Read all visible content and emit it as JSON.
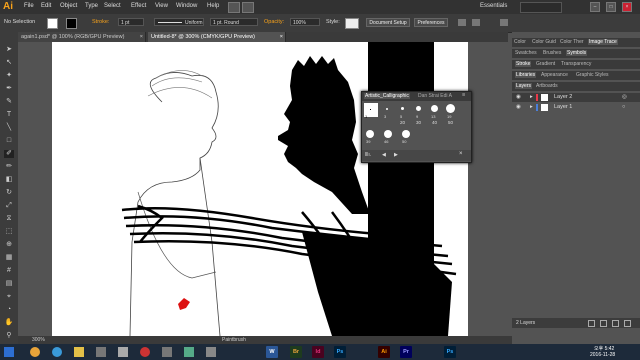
{
  "app": {
    "logo": "Ai",
    "workspace": "Essentials"
  },
  "menu": [
    "File",
    "Edit",
    "Object",
    "Type",
    "Select",
    "Effect",
    "View",
    "Window",
    "Help"
  ],
  "window_controls": [
    "–",
    "□",
    "×"
  ],
  "control_bar": {
    "selection": "No Selection",
    "stroke_label": "Stroke:",
    "stroke_value": "1 pt",
    "brush_line_label": "Uniform",
    "brush_label": "1 pt. Round",
    "opacity_label": "Opacity:",
    "opacity_value": "100%",
    "style_label": "Style:",
    "document_setup": "Document Setup",
    "preferences": "Preferences"
  },
  "tabs": [
    {
      "label": "again1.psd* @ 100% (RGB/GPU Preview)",
      "close": "×"
    },
    {
      "label": "Untitled-8* @ 300% (CMYK/GPU Preview)",
      "close": "×"
    }
  ],
  "brush_panel": {
    "title": "Artistic_Calligraphic",
    "extra_tabs": "Dan Strai Edi A",
    "sizes_row1": [
      "1",
      "3",
      "5",
      "9",
      "13",
      "19"
    ],
    "sizes_row2": [
      "20",
      "30",
      "40",
      "50"
    ],
    "sizes_row3": [
      "39",
      "46",
      "50"
    ],
    "footer_label": "lllı.",
    "close": "×",
    "menu": "≡"
  },
  "right_panels": {
    "top_tabs": [
      "Color",
      "Color Guid",
      "Color Ther",
      "Image Trace"
    ],
    "mid_tabs": [
      "Swatches",
      "Brushes",
      "Symbols"
    ],
    "stroke_tabs": [
      "Stroke",
      "Gradient",
      "Transparency"
    ],
    "lib_tabs": [
      "Libraries",
      "Appearance",
      "Graphic Styles"
    ],
    "layer_tabs": [
      "Layers",
      "Artboards"
    ],
    "layers": [
      {
        "name": "Layer 2",
        "color": "#e8394a",
        "selected": true
      },
      {
        "name": "Layer 1",
        "color": "#4a7ed8",
        "selected": false
      }
    ],
    "layer_count": "2 Layers"
  },
  "status": {
    "zoom": "300%",
    "tool": "Paintbrush"
  },
  "taskbar": {
    "apps": [
      {
        "label": "Br",
        "color": "#e7a33a"
      },
      {
        "label": "Id",
        "color": "#e5317b"
      },
      {
        "label": "Ps",
        "color": "#31a8ff"
      },
      {
        "label": "Ai",
        "color": "#ff9a00"
      },
      {
        "label": "Pr",
        "color": "#9999ff"
      },
      {
        "label": "W",
        "color": "#2b5797"
      },
      {
        "label": "Ps",
        "color": "#31a8ff"
      }
    ],
    "time": "오후 5:42",
    "date": "2016-11-28"
  }
}
